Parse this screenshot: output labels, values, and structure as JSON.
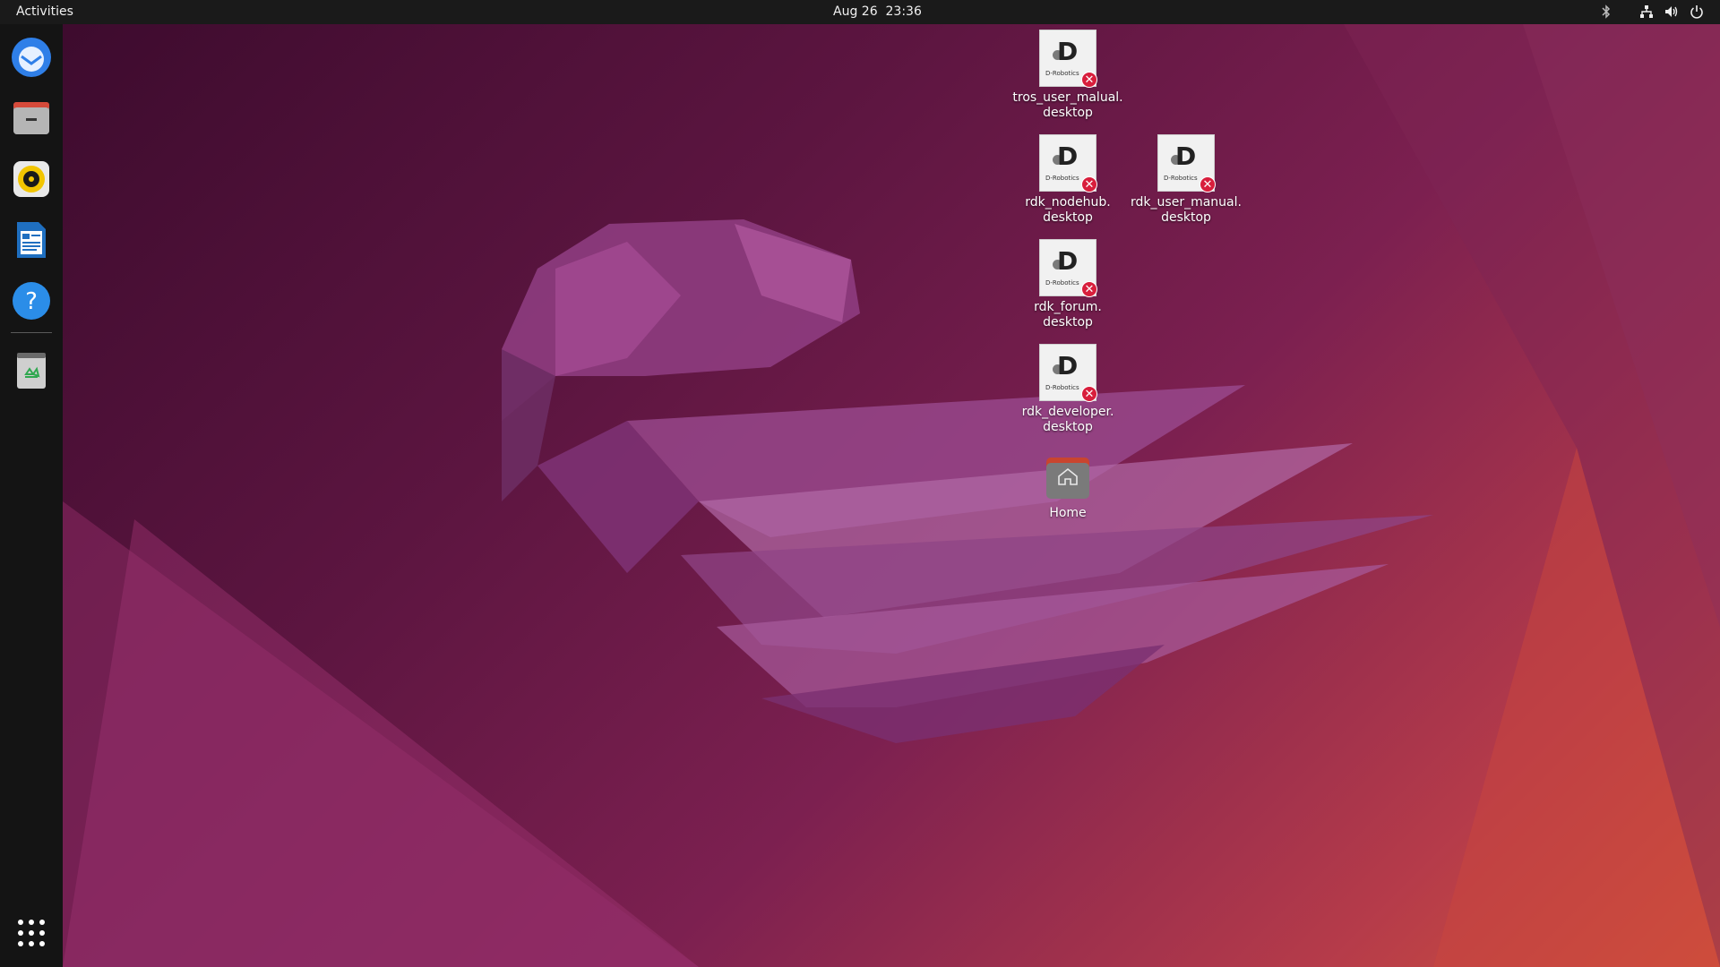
{
  "topbar": {
    "activities_label": "Activities",
    "clock": "Aug 26  23:36",
    "tray_icons": [
      "bluetooth-icon",
      "network-icon",
      "volume-icon",
      "power-icon"
    ]
  },
  "dock": {
    "items": [
      {
        "name": "thunderbird-icon",
        "color": "#2f7fe8"
      },
      {
        "name": "files-icon",
        "color": "#9a9a9a"
      },
      {
        "name": "rhythmbox-icon",
        "color": "#f2c500"
      },
      {
        "name": "writer-icon",
        "color": "#1f6fc0"
      },
      {
        "name": "help-icon",
        "color": "#2b8de8"
      },
      {
        "name": "trash-icon",
        "color": "#cfcfcf"
      }
    ],
    "app_grid": "show-applications-icon"
  },
  "desktop": {
    "icons": [
      {
        "line1": "tros_user_malual.",
        "line2": "desktop",
        "logo_text": "D-Robotics"
      },
      {
        "line1": "rdk_nodehub.",
        "line2": "desktop",
        "logo_text": "D-Robotics"
      },
      {
        "line1": "rdk_user_manual.",
        "line2": "desktop",
        "logo_text": "D-Robotics"
      },
      {
        "line1": "rdk_forum.",
        "line2": "desktop",
        "logo_text": "D-Robotics"
      },
      {
        "line1": "rdk_developer.",
        "line2": "desktop",
        "logo_text": "D-Robotics"
      }
    ],
    "home_label": "Home"
  },
  "colors": {
    "error_badge": "#d81e3c",
    "topbar_bg": "#1a1a1a",
    "dock_bg": "#141414"
  }
}
